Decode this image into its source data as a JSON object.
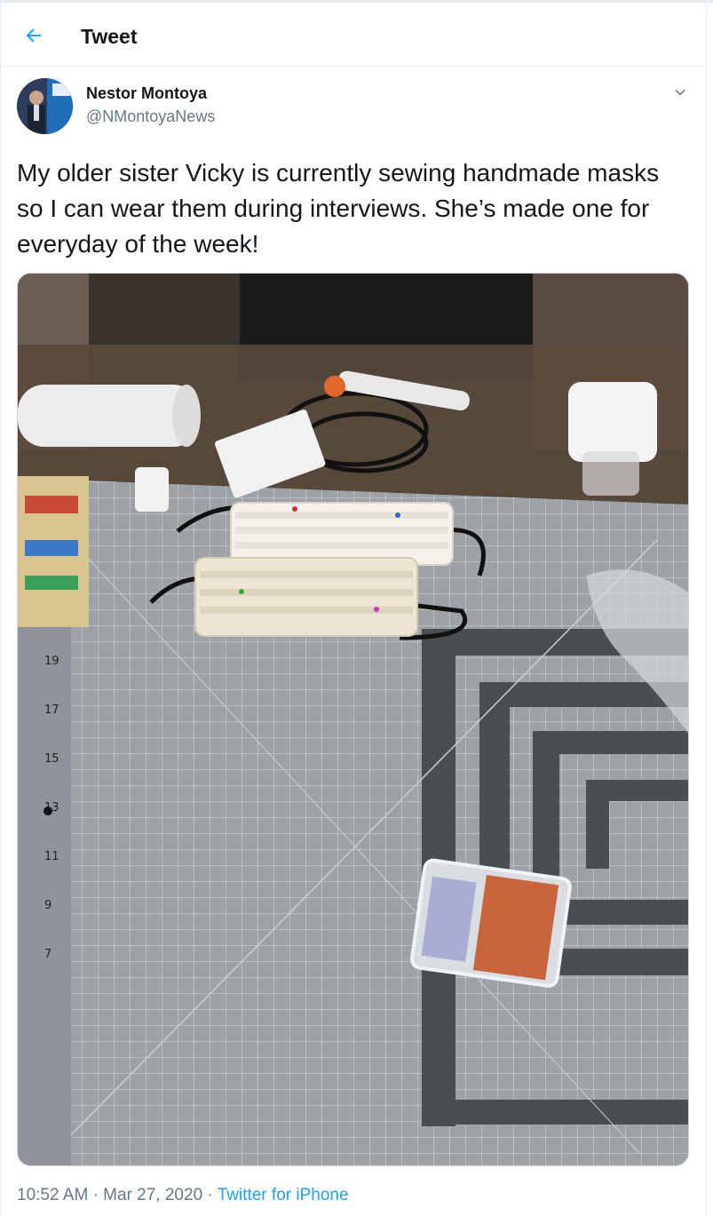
{
  "header": {
    "title": "Tweet"
  },
  "author": {
    "name": "Nestor Montoya",
    "handle": "@NMontoyaNews"
  },
  "tweet": {
    "text": "My older sister Vicky is currently sewing handmade masks so I can wear them during interviews. She’s made one for everyday of the week!",
    "time": "10:52 AM",
    "date": "Mar 27, 2020",
    "source": "Twitter for iPhone"
  },
  "icons": {
    "back": "arrow-left-icon",
    "more": "chevron-down-icon"
  },
  "colors": {
    "accent": "#1da1f2",
    "secondary_text": "#657786",
    "border": "#e6ecf0"
  }
}
